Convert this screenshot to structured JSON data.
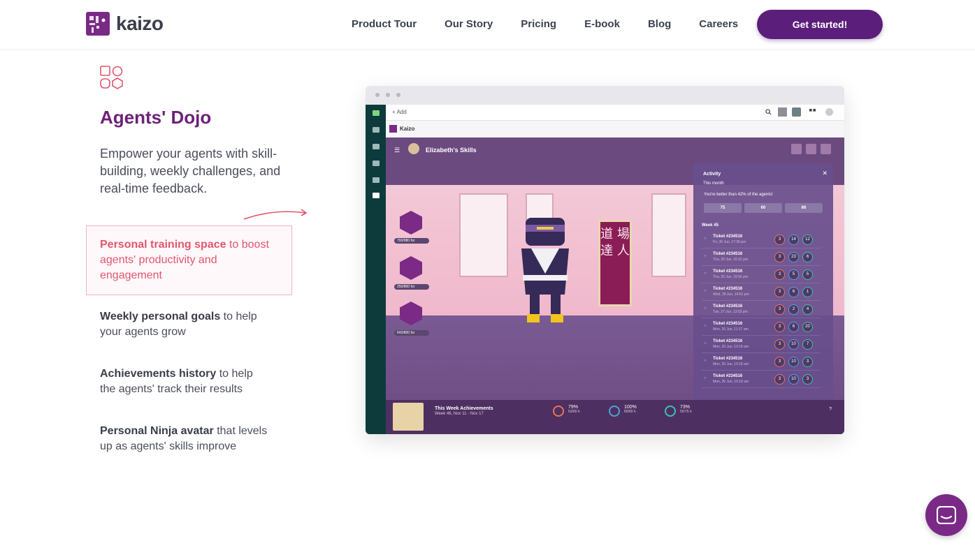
{
  "nav": {
    "brand": "kaizo",
    "links": [
      "Product Tour",
      "Our Story",
      "Pricing",
      "E-book",
      "Blog",
      "Careers"
    ],
    "cta": "Get started!"
  },
  "feature": {
    "title": "Agents' Dojo",
    "description": "Empower your agents with skill-building, weekly challenges, and real-time feedback.",
    "items": [
      {
        "bold": "Personal training space",
        "rest": " to boost agents' productivity and engagement",
        "active": true
      },
      {
        "bold": "Weekly personal goals",
        "rest": " to help your agents grow",
        "active": false
      },
      {
        "bold": "Achievements history",
        "rest": " to help the agents' track their results",
        "active": false
      },
      {
        "bold": "Personal Ninja avatar",
        "rest": " that levels up as agents' skills improve",
        "active": false
      }
    ]
  },
  "app": {
    "add_label": "+ Add",
    "workspace": "Kaizo",
    "skills_title": "Elizabeth's Skills",
    "skills": [
      {
        "label": "793/980 for",
        "progress": 0.81
      },
      {
        "label": "250/800 for",
        "progress": 0.31
      },
      {
        "label": "643/800 for",
        "progress": 0.8
      }
    ],
    "scroll_text": "道 場 達 人",
    "activity": {
      "title": "Activity",
      "period": "This month",
      "note": "You're better than 42% of the agents!",
      "stats": [
        "75",
        "60",
        "86"
      ],
      "week": "Week 45",
      "tickets": [
        {
          "name": "Ticket #234516",
          "date": "Fri, 30 Jun, 17:36 pm",
          "scores": [
            "3",
            "14",
            "12"
          ]
        },
        {
          "name": "Ticket #234516",
          "date": "Thu, 29 Jun, 16:22 pm",
          "scores": [
            "3",
            "23",
            "6"
          ]
        },
        {
          "name": "Ticket #234516",
          "date": "Thu, 29 Jun, 15:56 pm",
          "scores": [
            "3",
            "5",
            "5"
          ]
        },
        {
          "name": "Ticket #234516",
          "date": "Wed, 28 Jun, 14:01 pm",
          "scores": [
            "3",
            "6",
            "1"
          ]
        },
        {
          "name": "Ticket #234516",
          "date": "Tue, 27 Jun, 13:02 pm",
          "scores": [
            "3",
            "2",
            "4"
          ]
        },
        {
          "name": "Ticket #234516",
          "date": "Mon, 26 Jun, 11:17 am",
          "scores": [
            "3",
            "6",
            "20"
          ]
        },
        {
          "name": "Ticket #234516",
          "date": "Mon, 26 Jun, 10:18 am",
          "scores": [
            "3",
            "10",
            "7"
          ]
        },
        {
          "name": "Ticket #234516",
          "date": "Mon, 26 Jun, 10:18 am",
          "scores": [
            "3",
            "10",
            "3"
          ]
        },
        {
          "name": "Ticket #234516",
          "date": "Mon, 26 Jun, 10:18 am",
          "scores": [
            "3",
            "10",
            "3"
          ]
        }
      ]
    },
    "bottom": {
      "title": "This Week Achievements",
      "subtitle": "Week 46, Nov 11 - Nov 17",
      "stats": [
        {
          "value": "79%",
          "detail": "63/80 h"
        },
        {
          "value": "100%",
          "detail": "80/80 h"
        },
        {
          "value": "73%",
          "detail": "55/75 h"
        }
      ],
      "help": "?"
    }
  },
  "colors": {
    "brand": "#7a2a86",
    "cta": "#5b1e7a",
    "accent": "#e0566e",
    "title": "#6d2277"
  }
}
